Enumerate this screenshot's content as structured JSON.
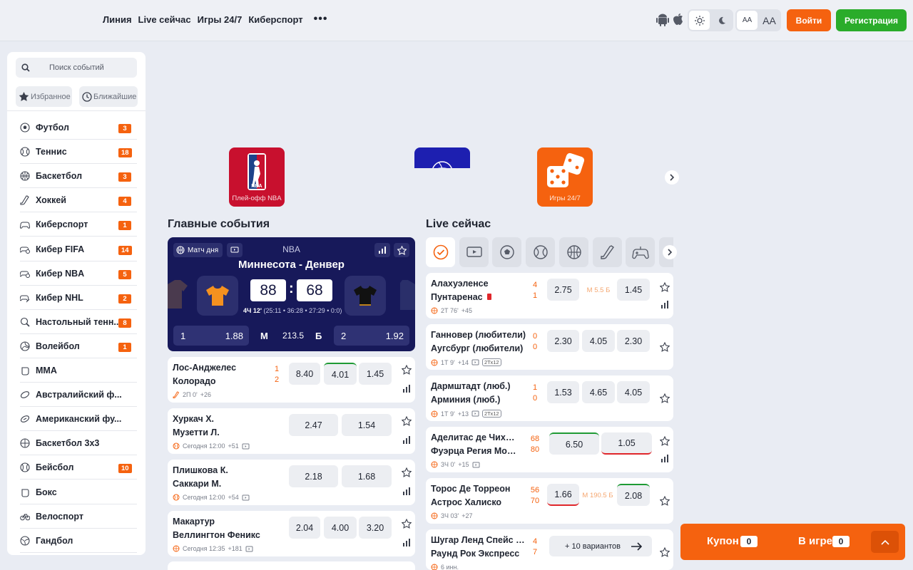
{
  "nav": {
    "items": [
      "Линия",
      "Live сейчас",
      "Игры 24/7",
      "Киберспорт"
    ],
    "more": "•••"
  },
  "header": {
    "font_small": "AA",
    "font_large": "AA",
    "login": "Войти",
    "register": "Регистрация"
  },
  "sidebar": {
    "search_placeholder": "Поиск событий",
    "favorites": "Избранное",
    "nearest": "Ближайшие",
    "sports": [
      {
        "label": "Футбол",
        "count": "3",
        "icon": "soccer-ball-icon"
      },
      {
        "label": "Теннис",
        "count": "18",
        "icon": "tennis-ball-icon"
      },
      {
        "label": "Баскетбол",
        "count": "3",
        "icon": "basketball-icon"
      },
      {
        "label": "Хоккей",
        "count": "4",
        "icon": "hockey-stick-icon"
      },
      {
        "label": "Киберспорт",
        "count": "1",
        "icon": "gamepad-icon"
      },
      {
        "label": "Кибер FIFA",
        "count": "14",
        "icon": "cyber-fifa-icon"
      },
      {
        "label": "Кибер NBA",
        "count": "5",
        "icon": "cyber-nba-icon"
      },
      {
        "label": "Кибер NHL",
        "count": "2",
        "icon": "cyber-nhl-icon"
      },
      {
        "label": "Настольный тенн...",
        "count": "8",
        "icon": "table-tennis-icon"
      },
      {
        "label": "Волейбол",
        "count": "1",
        "icon": "volleyball-icon"
      },
      {
        "label": "MMA",
        "count": "",
        "icon": "glove-icon"
      },
      {
        "label": "Австралийский ф...",
        "count": "",
        "icon": "aussie-ball-icon"
      },
      {
        "label": "Американский фу...",
        "count": "",
        "icon": "american-football-icon"
      },
      {
        "label": "Баскетбол 3х3",
        "count": "",
        "icon": "basketball-3x3-icon"
      },
      {
        "label": "Бейсбол",
        "count": "10",
        "icon": "baseball-icon"
      },
      {
        "label": "Бокс",
        "count": "",
        "icon": "boxing-icon"
      },
      {
        "label": "Велоспорт",
        "count": "",
        "icon": "bicycle-icon"
      },
      {
        "label": "Гандбол",
        "count": "",
        "icon": "handball-icon"
      }
    ]
  },
  "banners": [
    {
      "caption": "Плей-офф NBA"
    },
    {
      "caption": "Игры 24/7"
    }
  ],
  "main_events": {
    "title": "Главные события",
    "featured": {
      "tag": "Матч дня",
      "league": "NBA",
      "title": "Миннесота - Денвер",
      "score1": "88",
      "score2": "68",
      "colon": ":",
      "time": "4Ч 12'",
      "periods": "(25:11 • 36:28 • 27:29 • 0:0)",
      "odd1_label": "1",
      "odd1": "1.88",
      "mid_m": "М",
      "total": "213.5",
      "mid_b": "Б",
      "odd2_label": "2",
      "odd2": "1.92"
    },
    "rows": [
      {
        "t1": "Лос-Анджелес",
        "t2": "Колорадо",
        "s1": "1",
        "s2": "2",
        "meta": "2П 0'",
        "plus": "+26",
        "odds": [
          "8.40",
          "4.01",
          "1.45"
        ]
      },
      {
        "t1": "Хуркач Х.",
        "t2": "Музетти Л.",
        "meta": "Сегодня 12:00",
        "plus": "+51",
        "odds": [
          "2.47",
          "1.54"
        ]
      },
      {
        "t1": "Плишкова К.",
        "t2": "Саккари М.",
        "meta": "Сегодня 12:00",
        "plus": "+54",
        "odds": [
          "2.18",
          "1.68"
        ]
      },
      {
        "t1": "Макартур",
        "t2": "Веллингтон Феникс",
        "meta": "Сегодня 12:35",
        "plus": "+181",
        "odds": [
          "2.04",
          "4.00",
          "3.20"
        ]
      }
    ]
  },
  "live": {
    "title": "Live сейчас",
    "rows": [
      {
        "t1": "Алахуэленсе",
        "t2": "Пунтаренас",
        "s1": "4",
        "s2": "1",
        "meta": "2Т 76'",
        "plus": "+45",
        "odds": [
          "2.75",
          "1.45"
        ],
        "total": "М 5.5 Б"
      },
      {
        "t1": "Ганновер (любители)",
        "t2": "Аугсбург (любители)",
        "s1": "0",
        "s2": "0",
        "meta": "1Т 9'",
        "plus": "+14",
        "badge": "2Тх12",
        "odds": [
          "2.30",
          "4.05",
          "2.30"
        ]
      },
      {
        "t1": "Дармштадт (люб.)",
        "t2": "Арминия (люб.)",
        "s1": "1",
        "s2": "0",
        "meta": "1Т 9'",
        "plus": "+13",
        "badge": "2Тх12",
        "odds": [
          "1.53",
          "4.65",
          "4.05"
        ]
      },
      {
        "t1": "Аделитас де Чихуа...",
        "t2": "Фуэрца Регия Мон...",
        "s1": "68",
        "s2": "80",
        "meta": "3Ч 0'",
        "plus": "+15",
        "odds": [
          "6.50",
          "1.05"
        ]
      },
      {
        "t1": "Торос Де Торреон",
        "t2": "Астрос Халиско",
        "s1": "56",
        "s2": "70",
        "meta": "3Ч 03'",
        "plus": "+27",
        "odds": [
          "1.66",
          "2.08"
        ],
        "total": "М 190.5 Б"
      },
      {
        "t1": "Шугар Ленд Спейс К...",
        "t2": "Раунд Рок Экспресс",
        "s1": "4",
        "s2": "7",
        "meta": "6 инн.",
        "more": "+ 10 вариантов"
      }
    ]
  },
  "coupon": {
    "label": "Купон",
    "count": "0",
    "ingame": "В игре",
    "ingame_count": "0"
  },
  "colors": {
    "accent": "#f5620f",
    "green": "#2aac2a",
    "navy": "#17195a"
  }
}
